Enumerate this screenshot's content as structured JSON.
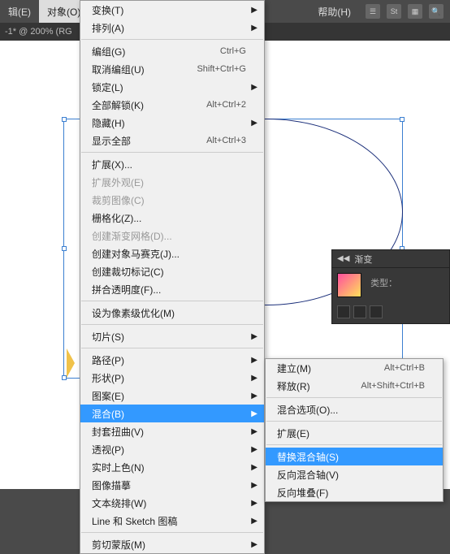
{
  "topbar": {
    "menu_edit": "辑(E)",
    "menu_object": "对象(O)",
    "menu_help": "帮助(H)"
  },
  "docbar": {
    "text": "-1* @ 200% (RG"
  },
  "main_menu": {
    "transform": "变换(T)",
    "arrange": "排列(A)",
    "group": "编组(G)",
    "group_sc": "Ctrl+G",
    "ungroup": "取消编组(U)",
    "ungroup_sc": "Shift+Ctrl+G",
    "lock": "锁定(L)",
    "unlock_all": "全部解锁(K)",
    "unlock_all_sc": "Alt+Ctrl+2",
    "hide": "隐藏(H)",
    "show_all": "显示全部",
    "show_all_sc": "Alt+Ctrl+3",
    "expand": "扩展(X)...",
    "expand_appearance": "扩展外观(E)",
    "crop_image": "裁剪图像(C)",
    "rasterize": "栅格化(Z)...",
    "create_gradient_mesh": "创建渐变网格(D)...",
    "create_object_mosaic": "创建对象马赛克(J)...",
    "create_trim_marks": "创建裁切标记(C)",
    "flatten_transparency": "拼合透明度(F)...",
    "pixel_optimize": "设为像素级优化(M)",
    "slice": "切片(S)",
    "path": "路径(P)",
    "shape": "形状(P)",
    "pattern": "图案(E)",
    "blend": "混合(B)",
    "envelope": "封套扭曲(V)",
    "perspective": "透视(P)",
    "live_paint": "实时上色(N)",
    "image_trace": "图像描摹",
    "text_wrap": "文本绕排(W)",
    "line_sketch": "Line 和 Sketch 图稿",
    "clipping_mask": "剪切蒙版(M)"
  },
  "submenu": {
    "make": "建立(M)",
    "make_sc": "Alt+Ctrl+B",
    "release": "释放(R)",
    "release_sc": "Alt+Shift+Ctrl+B",
    "options": "混合选项(O)...",
    "expand_sm": "扩展(E)",
    "replace_spine": "替换混合轴(S)",
    "reverse_spine": "反向混合轴(V)",
    "reverse_front_back": "反向堆叠(F)"
  },
  "panel": {
    "tab_gradient": "渐变",
    "type_label": "类型："
  }
}
